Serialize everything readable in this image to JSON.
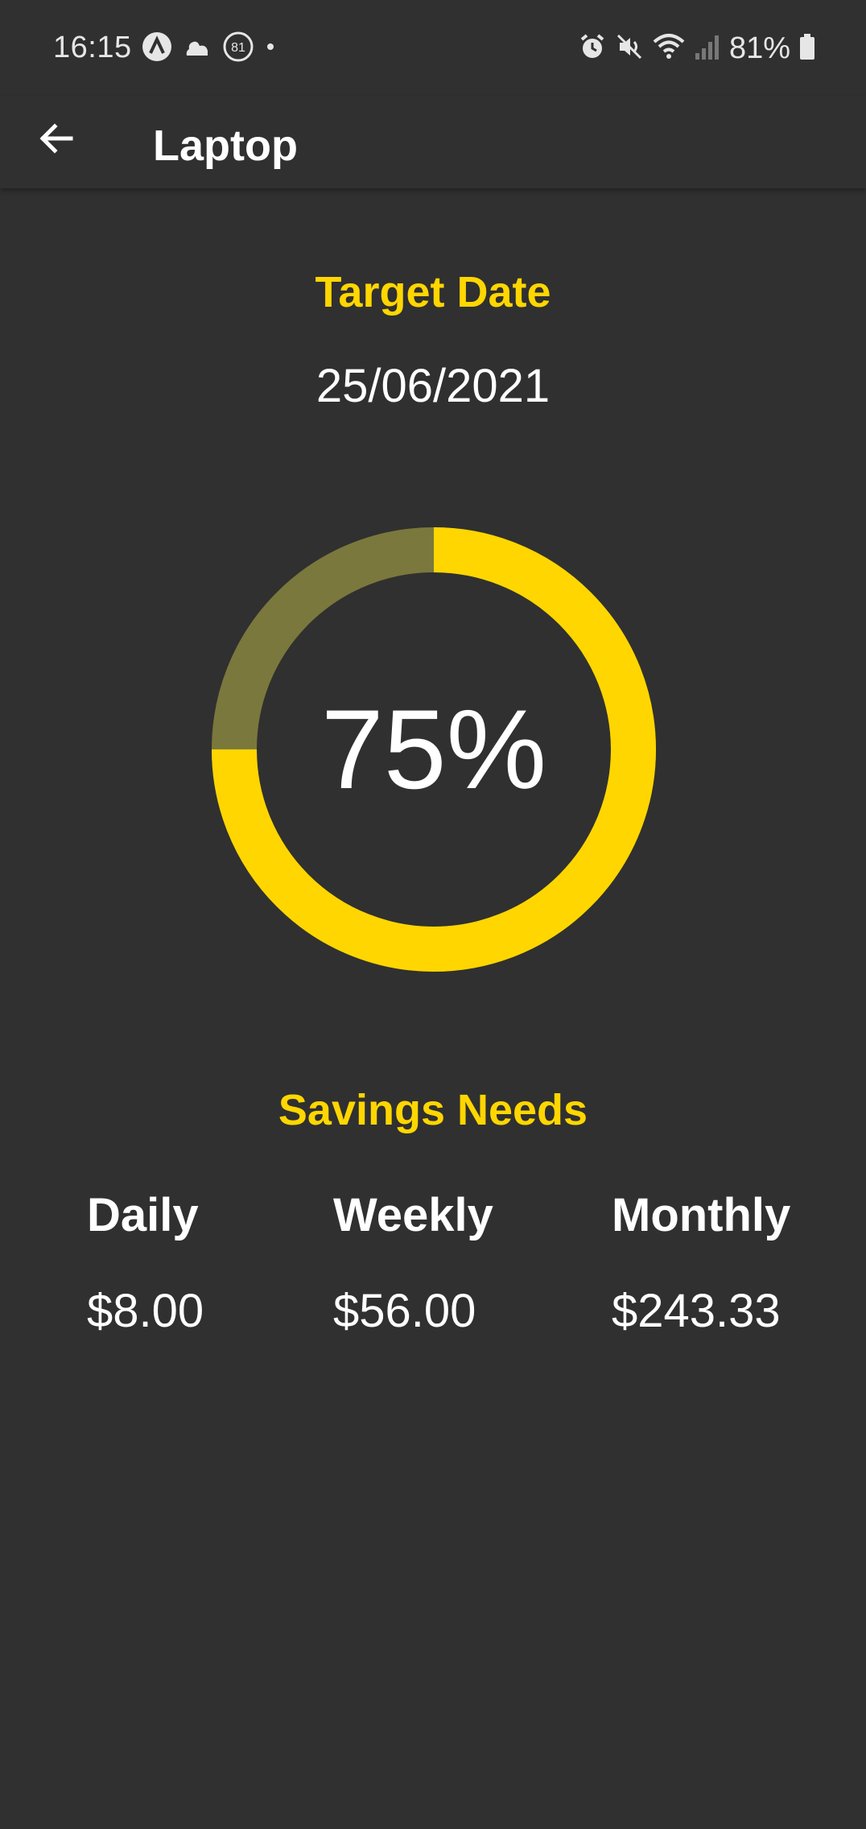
{
  "status_bar": {
    "time": "16:15",
    "notification_badge": "81",
    "battery": "81%",
    "icons": [
      "app-a-icon",
      "cloud-icon",
      "badge-icon",
      "dot-icon",
      "alarm-icon",
      "mute-icon",
      "wifi-icon",
      "signal-icon",
      "battery-icon"
    ]
  },
  "app_bar": {
    "title": "Laptop",
    "back_icon": "arrow-left-icon"
  },
  "target": {
    "label": "Target Date",
    "date": "25/06/2021"
  },
  "progress": {
    "percent_text": "75%",
    "value": 0.75,
    "colors": {
      "filled": "#ffd600",
      "remaining": "#7a783c"
    }
  },
  "savings": {
    "title": "Savings Needs",
    "columns": [
      {
        "label": "Daily",
        "value": "$8.00"
      },
      {
        "label": "Weekly",
        "value": "$56.00"
      },
      {
        "label": "Monthly",
        "value": "$243.33"
      }
    ]
  },
  "colors": {
    "background": "#303030",
    "accent": "#ffd600",
    "text": "#ffffff"
  }
}
